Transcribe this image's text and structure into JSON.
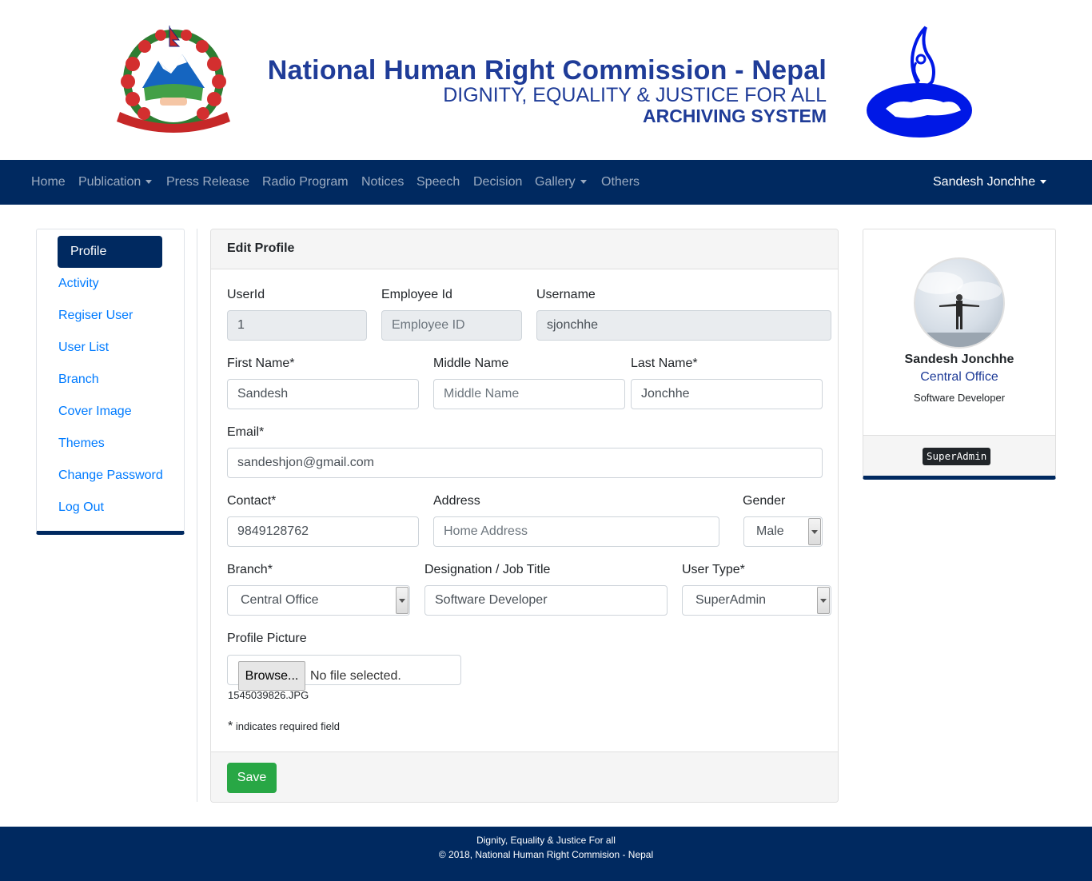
{
  "header": {
    "title": "National Human Right Commission - Nepal",
    "subtitle": "DIGNITY, EQUALITY & JUSTICE FOR ALL",
    "system": "ARCHIVING SYSTEM"
  },
  "nav": {
    "items": [
      "Home",
      "Publication",
      "Press Release",
      "Radio Program",
      "Notices",
      "Speech",
      "Decision",
      "Gallery",
      "Others"
    ],
    "user": "Sandesh Jonchhe"
  },
  "sidebar": {
    "items": [
      "Profile",
      "Activity",
      "Regiser User",
      "User List",
      "Branch",
      "Cover Image",
      "Themes",
      "Change Password",
      "Log Out"
    ]
  },
  "form": {
    "title": "Edit Profile",
    "userid": {
      "label": "UserId",
      "value": "1"
    },
    "employee_id": {
      "label": "Employee Id",
      "placeholder": "Employee ID"
    },
    "username": {
      "label": "Username",
      "value": "sjonchhe"
    },
    "first_name": {
      "label": "First Name*",
      "value": "Sandesh"
    },
    "middle_name": {
      "label": "Middle Name",
      "placeholder": "Middle Name"
    },
    "last_name": {
      "label": "Last Name*",
      "value": "Jonchhe"
    },
    "email": {
      "label": "Email*",
      "value": "sandeshjon@gmail.com"
    },
    "contact": {
      "label": "Contact*",
      "value": "9849128762"
    },
    "address": {
      "label": "Address",
      "placeholder": "Home Address"
    },
    "gender": {
      "label": "Gender",
      "value": "Male"
    },
    "branch": {
      "label": "Branch*",
      "value": "Central Office"
    },
    "designation": {
      "label": "Designation / Job Title",
      "value": "Software Developer"
    },
    "user_type": {
      "label": "User Type*",
      "value": "SuperAdmin"
    },
    "profile_picture": {
      "label": "Profile Picture",
      "browse": "Browse...",
      "status": "No file selected.",
      "current_file": "1545039826.JPG"
    },
    "required_star": "*",
    "required_note": "indicates required field",
    "save": "Save"
  },
  "profile_card": {
    "name": "Sandesh Jonchhe",
    "branch": "Central Office",
    "designation": "Software Developer",
    "role": "SuperAdmin"
  },
  "footer": {
    "line1": "Dignity, Equality & Justice For all",
    "line2": "© 2018, National Human Right Commision - Nepal"
  },
  "colors": {
    "primary": "#002960",
    "title_blue": "#1f3c98",
    "link": "#007bff",
    "success": "#28a745"
  },
  "icons": [
    "nepal-emblem-icon",
    "nhrc-logo-icon",
    "dropdown-caret-icon",
    "select-arrow-icon",
    "avatar-photo"
  ]
}
